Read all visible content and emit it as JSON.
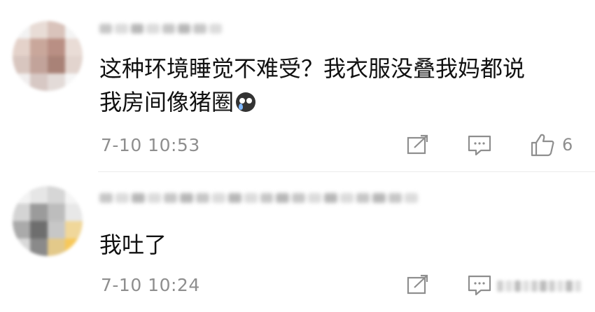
{
  "comments": [
    {
      "text_lines": [
        "这种环境睡觉不难受？我衣服没叠我妈都说",
        "我房间像猪圈"
      ],
      "emoji": "crying-face-emoji",
      "time": "7-10 10:53",
      "like_count": "6",
      "actions": [
        "share-icon",
        "comment-icon",
        "like-icon"
      ]
    },
    {
      "text_lines": [
        "我吐了"
      ],
      "time": "7-10 10:24",
      "actions": [
        "share-icon",
        "comment-icon"
      ]
    }
  ],
  "colors": {
    "text": "#111111",
    "meta": "#8e8e8e",
    "divider": "#ececec",
    "background": "#ffffff"
  }
}
